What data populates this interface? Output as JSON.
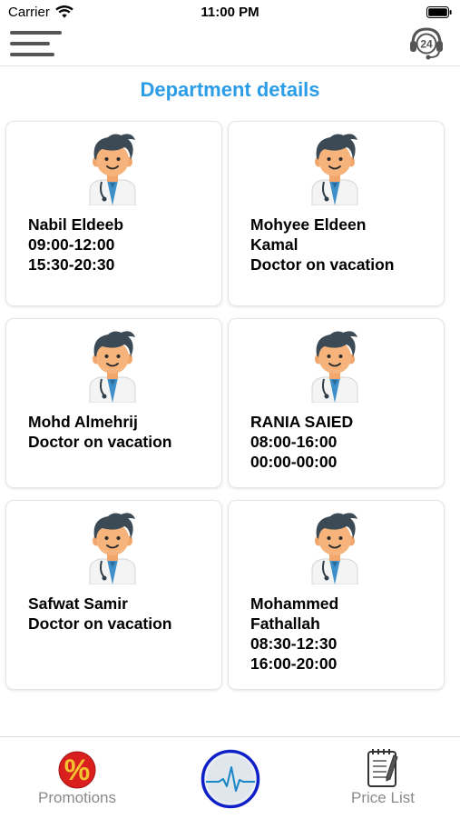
{
  "status": {
    "carrier": "Carrier",
    "time": "11:00 PM"
  },
  "header": {
    "menu_icon": "hamburger-menu-icon",
    "support_icon": "24h-support-headset-icon",
    "support_badge": "24"
  },
  "page": {
    "title": "Department details"
  },
  "doctors": [
    {
      "lines": [
        "Nabil Eldeeb",
        "09:00-12:00",
        "15:30-20:30"
      ]
    },
    {
      "lines": [
        "Mohyee Eldeen",
        "Kamal",
        "Doctor on vacation"
      ]
    },
    {
      "lines": [
        "Mohd Almehrij",
        "Doctor on vacation"
      ]
    },
    {
      "lines": [
        "RANIA SAIED",
        "08:00-16:00",
        "00:00-00:00"
      ]
    },
    {
      "lines": [
        "Safwat Samir",
        "Doctor on vacation"
      ]
    },
    {
      "lines": [
        "Mohammed",
        "Fathallah",
        "08:30-12:30",
        "16:00-20:00"
      ]
    }
  ],
  "tabs": {
    "promotions": {
      "label": "Promotions",
      "icon": "percent-icon",
      "glyph": "%"
    },
    "home": {
      "label": "",
      "icon": "heartbeat-icon"
    },
    "price_list": {
      "label": "Price List",
      "icon": "notepad-icon"
    }
  },
  "colors": {
    "title": "#2b9ce6",
    "promo_red": "#d9201f",
    "home_ring": "#1020c8"
  }
}
